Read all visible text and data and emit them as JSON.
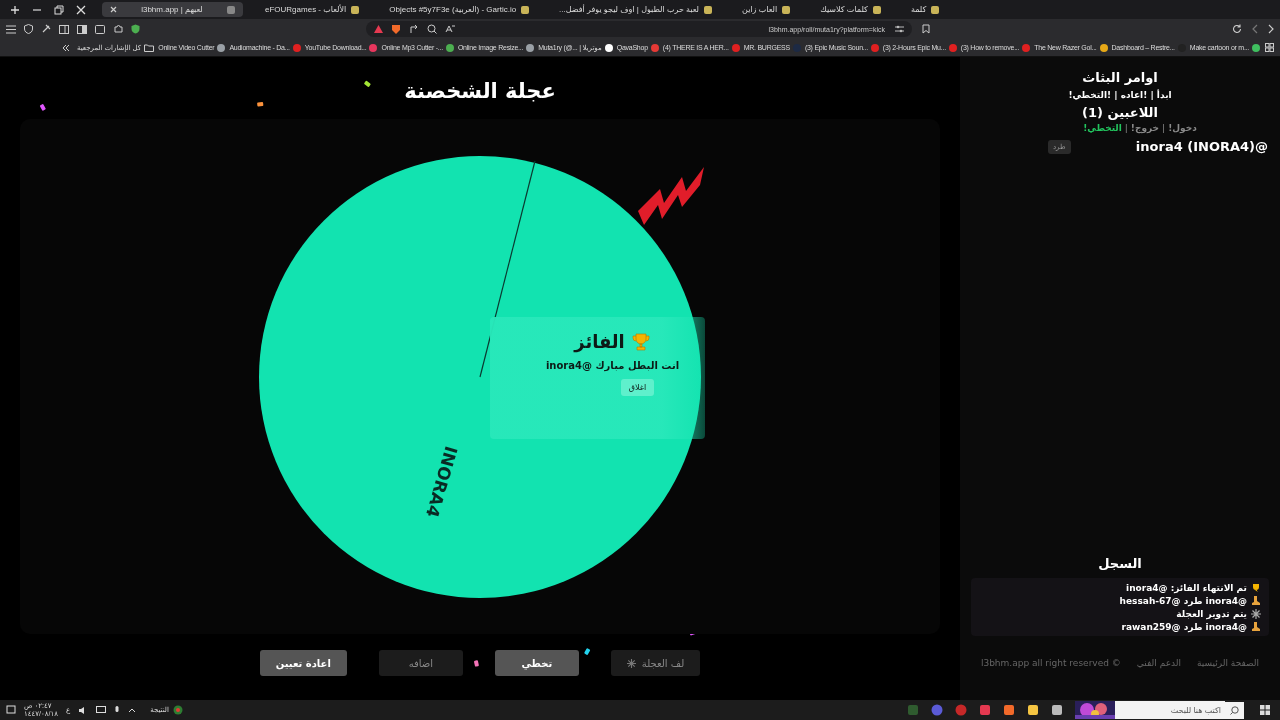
{
  "browser": {
    "tabs": [
      {
        "label": "كلمة",
        "selected": false
      },
      {
        "label": "كلمات كلاسيك",
        "selected": false
      },
      {
        "label": "العاب زاين",
        "selected": false
      },
      {
        "label": "لعبة حرب الطبول | اوف ليجو يوفر أفضل...",
        "selected": false
      },
      {
        "label": "Objects #5y7F3e (العربية) - Gartic.io",
        "selected": false
      },
      {
        "label": "eFOURgames - الألعاب",
        "selected": false
      },
      {
        "label": "l3bhm.app | لعبهم",
        "selected": true
      }
    ],
    "address": "l3bhm.app/roll/muta1ry?platform=kick",
    "bookmarks_folder": "كل الإشارات المرجعية",
    "bookmarks": [
      {
        "label": "Make cartoon or m...",
        "color": "#3fbf5f"
      },
      {
        "label": "Dashboard – Restre...",
        "color": "#222222"
      },
      {
        "label": "The New Razer Gol...",
        "color": "#e6a817"
      },
      {
        "label": "(3) How to remove...",
        "color": "#e02020"
      },
      {
        "label": "(3) 2-Hours Epic Mu...",
        "color": "#e02020"
      },
      {
        "label": "(3) Epic Music Soun...",
        "color": "#e02020"
      },
      {
        "label": "MR. BURGESS",
        "color": "#1d2a44"
      },
      {
        "label": "(4) THERE IS A HER...",
        "color": "#e02020"
      },
      {
        "label": "QavaShop",
        "color": "#e53935"
      },
      {
        "label": "Muta1ry (@... | موتريلا",
        "color": "#ffffff"
      },
      {
        "label": "Online Image Resize...",
        "color": "#9aa0a6"
      },
      {
        "label": "Online Mp3 Cutter -...",
        "color": "#4caf50"
      },
      {
        "label": "YouTube Download...",
        "color": "#e8365d"
      },
      {
        "label": "Audiomachine - Da...",
        "color": "#e02020"
      },
      {
        "label": "Online Video Cutter",
        "color": "#9aa0a6"
      }
    ]
  },
  "wheel": {
    "title": "عجلة الشخصنة",
    "segments": [
      {
        "label": "INORA4",
        "color": "#12e3b0"
      }
    ]
  },
  "winner_dialog": {
    "title": "الفائز",
    "message": "انت البطل مبارك @inora4",
    "close_button": "اغلاق"
  },
  "controls": [
    {
      "label": "لف العجلة",
      "disabled": true
    },
    {
      "label": "تخطي",
      "disabled": false
    },
    {
      "label": "اضافه",
      "disabled": true
    },
    {
      "label": "اعادة تعيين",
      "disabled": false
    }
  ],
  "sidebar": {
    "commands_title": "اوامر البثاث",
    "commands": "!ابدأ | !اعاده | !التخطي",
    "players_title": "اللاعبين (1)",
    "command_separator": "|",
    "player_commands": [
      {
        "label": "!دخول",
        "color": "#8a8a8a"
      },
      {
        "label": "!خروج",
        "color": "#8a8a8a"
      },
      {
        "label": "!التخطي",
        "color": "#22c55e"
      }
    ],
    "players": [
      {
        "name": "inora4 (INORA4)@",
        "kick_button": "طرد"
      }
    ],
    "log_title": "السجل",
    "log": [
      {
        "kind": "trophy",
        "text": "تم الانتهاء الفائز: @inora4"
      },
      {
        "kind": "boot",
        "text": "@inora4 طرد @hessah-67"
      },
      {
        "kind": "sparkle",
        "text": "يتم تدوير العجلة"
      },
      {
        "kind": "boot",
        "text": "@inora4 طرد @rawan259"
      }
    ],
    "footer_links": [
      "الصفحة الرئيسية",
      "الدعم الفني"
    ],
    "copyright": "l3bhm.app all right reserved ©"
  },
  "taskbar": {
    "search_placeholder": "اكتب هنا للبحث",
    "weather": "النتيجة",
    "language": "ع",
    "time": "٠٢:٤٧ ص",
    "date": "١٤٤٧/٠٨/١٨"
  }
}
